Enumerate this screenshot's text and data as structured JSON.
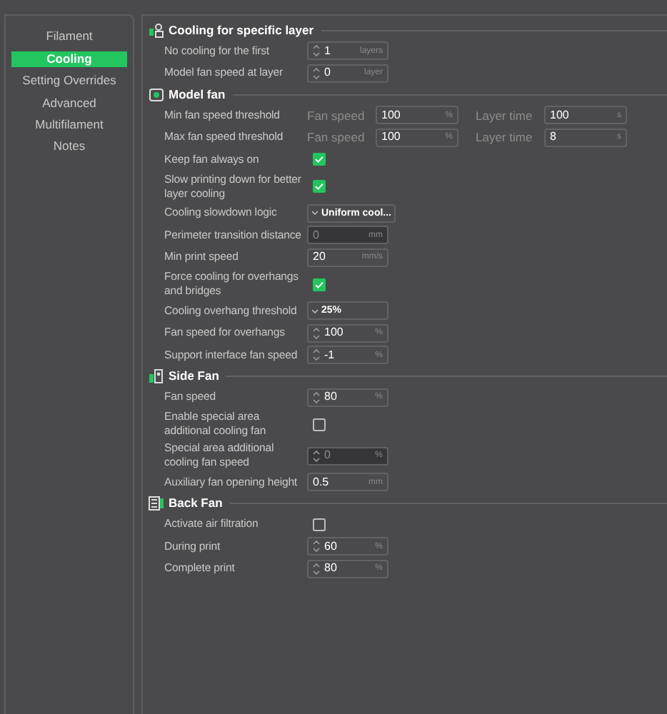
{
  "sidebar": {
    "items": [
      {
        "label": "Filament",
        "selected": false
      },
      {
        "label": "Cooling",
        "selected": true
      },
      {
        "label": "Setting Overrides",
        "selected": false
      },
      {
        "label": "Advanced",
        "selected": false
      },
      {
        "label": "Multifilament",
        "selected": false
      },
      {
        "label": "Notes",
        "selected": false
      }
    ]
  },
  "sections": [
    {
      "title": "Cooling for specific layer",
      "rows": [
        {
          "kind": "spin",
          "label": "No cooling for the first",
          "value": "1",
          "unit": "layers",
          "disabled": false
        },
        {
          "kind": "spin",
          "label": "Model fan speed at layer",
          "value": "0",
          "unit": "layer",
          "disabled": false
        }
      ]
    },
    {
      "title": "Model fan",
      "rows": [
        {
          "kind": "dual",
          "label": "Min fan speed threshold",
          "fields": [
            {
              "label": "Fan speed",
              "value": "100",
              "unit": "%"
            },
            {
              "label": "Layer time",
              "value": "100",
              "unit": "s"
            }
          ]
        },
        {
          "kind": "dual",
          "label": "Max fan speed threshold",
          "fields": [
            {
              "label": "Fan speed",
              "value": "100",
              "unit": "%"
            },
            {
              "label": "Layer time",
              "value": "8",
              "unit": "s"
            }
          ]
        },
        {
          "kind": "check",
          "label": "Keep fan always on",
          "checked": true
        },
        {
          "kind": "check",
          "label": "Slow printing down for better layer cooling",
          "checked": true
        },
        {
          "kind": "dropdown",
          "label": "Cooling slowdown logic",
          "value": "Uniform cool..."
        },
        {
          "kind": "text",
          "label": "Perimeter transition distance",
          "value": "0",
          "unit": "mm",
          "disabled": true
        },
        {
          "kind": "text",
          "label": "Min print speed",
          "value": "20",
          "unit": "mm/s",
          "disabled": false
        },
        {
          "kind": "check",
          "label": "Force cooling for overhangs and bridges",
          "checked": true
        },
        {
          "kind": "dropdown",
          "label": "Cooling overhang threshold",
          "value": "25%"
        },
        {
          "kind": "spin",
          "label": "Fan speed for overhangs",
          "value": "100",
          "unit": "%",
          "disabled": false
        },
        {
          "kind": "spin",
          "label": "Support interface fan speed",
          "value": "-1",
          "unit": "%",
          "disabled": false
        }
      ]
    },
    {
      "title": "Side Fan",
      "rows": [
        {
          "kind": "spin",
          "label": "Fan speed",
          "value": "80",
          "unit": "%",
          "disabled": false
        },
        {
          "kind": "check",
          "label": "Enable special area additional cooling fan",
          "checked": false
        },
        {
          "kind": "spin",
          "label": "Special area additional cooling fan speed",
          "value": "0",
          "unit": "%",
          "disabled": true
        },
        {
          "kind": "text",
          "label": "Auxiliary fan opening height",
          "value": "0.5",
          "unit": "mm",
          "disabled": false
        }
      ]
    },
    {
      "title": "Back Fan",
      "rows": [
        {
          "kind": "check",
          "label": "Activate air filtration",
          "checked": false
        },
        {
          "kind": "spin",
          "label": "During print",
          "value": "60",
          "unit": "%",
          "disabled": false
        },
        {
          "kind": "spin",
          "label": "Complete print",
          "value": "80",
          "unit": "%",
          "disabled": false
        }
      ]
    }
  ]
}
